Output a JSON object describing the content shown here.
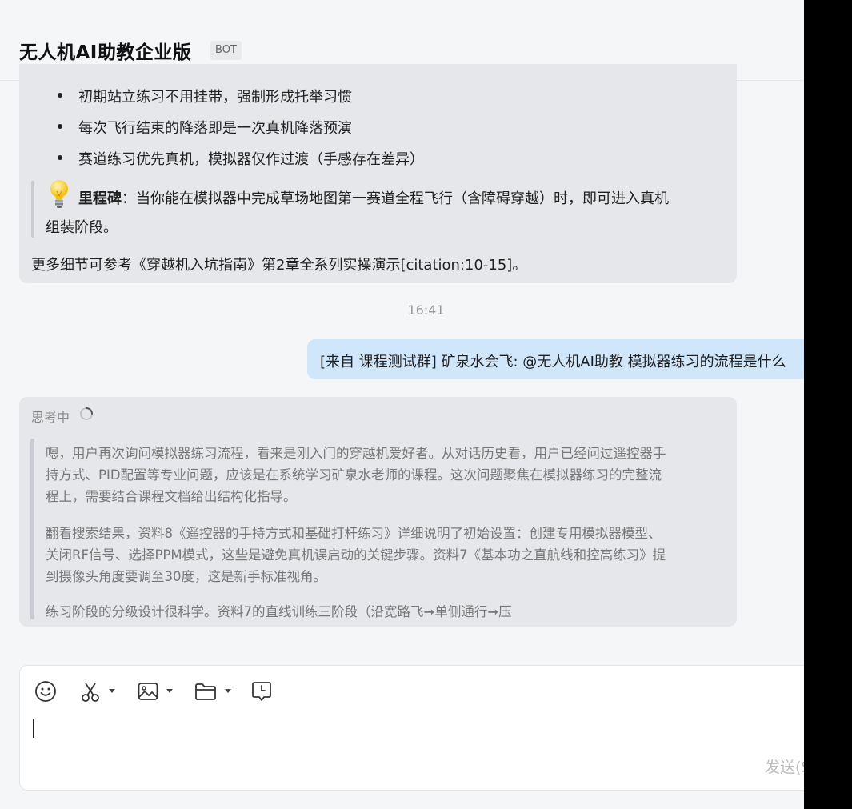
{
  "window": {
    "minimize_icon": "minimize-icon",
    "maximize_icon": "maximize-icon"
  },
  "header": {
    "title": "无人机AI助教企业版",
    "badge": "BOT"
  },
  "messages": {
    "bot_answer": {
      "bullets": [
        "初期站立练习不用挂带，强制形成托举习惯",
        "每次飞行结束的降落即是一次真机降落预演",
        "赛道练习优先真机，模拟器仅作过渡（手感存在差异）"
      ],
      "milestone_icon": "lightbulb-icon",
      "milestone_label": "里程碑",
      "milestone_text_1": "：当你能在模拟器中完成草场地图第一赛道全程飞行（含障碍穿越）时，即可进入真机",
      "milestone_text_2": "组装阶段。",
      "reference": "更多细节可参考《穿越机入坑指南》第2章全系列实操演示[citation:10-15]。"
    },
    "timestamp": "16:41",
    "user_message": "[来自 课程测试群] 矿泉水会飞: @无人机AI助教 模拟器练习的流程是什么",
    "bot_thinking": {
      "label": "思考中",
      "lines": [
        "嗯，用户再次询问模拟器练习流程，看来是刚入门的穿越机爱好者。从对话历史看，用户已经问过遥控器手",
        "持方式、PID配置等专业问题，应该是在系统学习矿泉水老师的课程。这次问题聚焦在模拟器练习的完整流",
        "程上，需要结合课程文档给出结构化指导。",
        "翻看搜索结果，资料8《遥控器的手持方式和基础打杆练习》详细说明了初始设置：创建专用模拟器模型、",
        "关闭RF信号、选择PPM模式，这些是避免真机误启动的关键步骤。资料7《基本功之直航线和控高练习》提",
        "到摄像头角度要调至30度，这是新手标准视角。",
        "练习阶段的分级设计很科学。资料7的直线训练三阶段（沿宽路飞➞单侧通行➞压"
      ]
    }
  },
  "composer": {
    "tools": [
      "emoji-icon",
      "scissors-icon",
      "image-icon",
      "folder-icon",
      "history-icon"
    ],
    "send_label": "发送(S)"
  },
  "colors": {
    "background": "#f5f6f8",
    "bot_bubble": "#e5e7eb",
    "user_bubble": "#cfe6fb",
    "quote_bar": "#c8cbd1"
  }
}
